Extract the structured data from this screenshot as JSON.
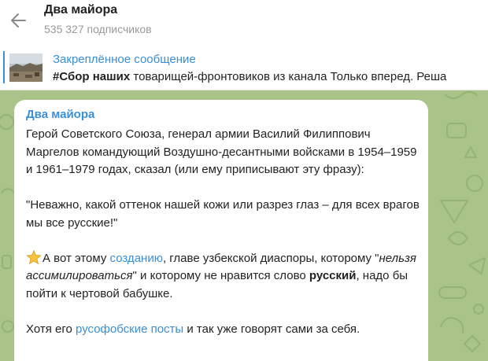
{
  "header": {
    "back_icon": "arrow-left-icon",
    "title": "Два майора",
    "subscribers": "535 327 подписчиков"
  },
  "pinned": {
    "title": "Закреплённое сообщение",
    "text_bold": "#Сбор наших",
    "text_rest": " товарищей-фронтовиков из канала Только вперед. Реша"
  },
  "message": {
    "sender": "Два майора",
    "para1": "Герой Советского Союза, генерал армии Василий Филиппович Маргелов командующий Воздушно-десантными войсками в 1954–1959 и 1961–1979 годах, сказал (или ему приписывают эту фразу):",
    "quote": "\"Неважно, какой оттенок нашей кожи или разрез глаз – для всех врагов мы все русские!\"",
    "p3_a": "А вот этому ",
    "p3_link": "созданию",
    "p3_b": ", главе узбекской диаспоры, которому \"",
    "p3_italic": "нельзя ассимилироваться",
    "p3_c": "\" и которому не нравится слово ",
    "p3_bold": "русский",
    "p3_d": ", надо бы пойти к чертовой бабушке.",
    "p4_a": "Хотя его ",
    "p4_link": "русофобские посты",
    "p4_b": " и так уже говорят сами за себя.",
    "star_icon": "star-emoji-icon"
  },
  "colors": {
    "accent": "#3a8fd6",
    "chat_background": "#a9c389",
    "bubble": "#ffffff"
  }
}
